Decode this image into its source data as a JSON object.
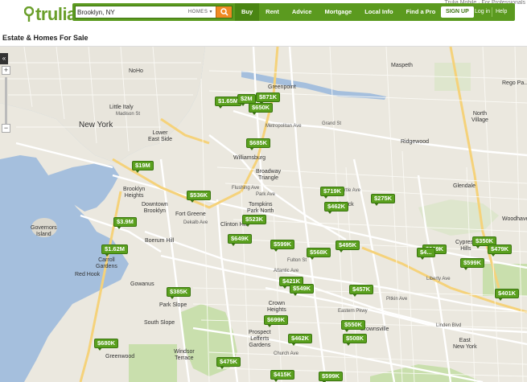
{
  "brand": {
    "logo_text": "trulia"
  },
  "header": {
    "top_links": "Trulia Mobile · For Professionals",
    "search_value": "Brooklyn, NY",
    "search_type": "HOMES ▾",
    "nav": [
      "Buy",
      "Rent",
      "Advice",
      "Mortgage",
      "Local Info",
      "Find a Pro"
    ],
    "signup": "SIGN UP",
    "login": "Log in",
    "help": "Help"
  },
  "page": {
    "title": "Estate & Homes For Sale"
  },
  "controls": {
    "collapse": "«",
    "zoom_in": "+",
    "zoom_out": "−"
  },
  "prices": [
    "$1.65M",
    "$2M",
    "$871K",
    "$650K",
    "$685K",
    "$19M",
    "$536K",
    "$719K",
    "$275K",
    "$3.9M",
    "$462K",
    "$523K",
    "$649K",
    "$1.62M",
    "$599K",
    "$568K",
    "$495K",
    "$369K",
    "$350K",
    "$479K",
    "$599K",
    "$421K",
    "$549K",
    "$385K",
    "$457K",
    "$401K",
    "$699K",
    "$550K",
    "$680K",
    "$462K",
    "$508K",
    "$475K",
    "$415K",
    "$599K",
    "$4..."
  ],
  "places": {
    "noho": "NoHo",
    "little_italy": "Little Italy",
    "new_york": "New York",
    "lower_east_side": "Lower\nEast Side",
    "madison": "Madison St",
    "greenpoint": "Greenpoint",
    "maspeth": "Maspeth",
    "williamsburg": "Williamsburg",
    "broadway_triangle": "Broadway\nTriangle",
    "ridgewood": "Ridgewood",
    "north_village": "North\nVillage",
    "glendale": "Glendale",
    "brooklyn_heights": "Brooklyn\nHeights",
    "downtown_brooklyn": "Downtown\nBrooklyn",
    "fort_greene": "Fort Greene",
    "clinton_hill": "Clinton Hill",
    "tompkins_park_north": "Tompkins\nPark North",
    "bushwick": "Bushwick",
    "governors_island": "Governors\nIsland",
    "boerum_hill": "Boerum Hill",
    "carroll_gardens": "Carroll\nGardens",
    "red_hook": "Red Hook",
    "gowanus": "Gowanus",
    "park_slope": "Park Slope",
    "south_slope": "South Slope",
    "crown_heights": "Crown\nHeights",
    "prospect_lefferts": "Prospect\nLefferts\nGardens",
    "brownsville": "Brownsville",
    "greenwood": "Greenwood",
    "windsor_terrace": "Windsor\nTerrace",
    "east_new_york": "East\nNew York",
    "cypress_hills": "Cypress\nHills",
    "woodhaven": "Woodhaven",
    "rego_park": "Rego Pa...",
    "atlantic_ave": "Atlantic Ave",
    "fulton_st": "Fulton St",
    "metropolitan_ave": "Metropolitan Ave",
    "myrtle_ave": "Myrtle Ave",
    "grand_st": "Grand St",
    "flushing_ave": "Flushing Ave",
    "park_ave": "Park Ave",
    "dekalb_ave": "Dekalb Ave",
    "linden_blvd": "Linden Blvd",
    "pitkin_ave": "Pitkin Ave",
    "liberty_ave": "Liberty Ave",
    "church_ave": "Church Ave",
    "eastern_pkwy": "Eastern Pkwy"
  }
}
